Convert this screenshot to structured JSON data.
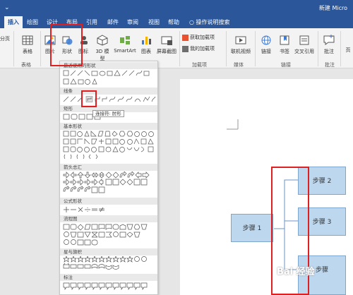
{
  "window": {
    "title": "新建 Micro"
  },
  "tabs": [
    {
      "label": "插入",
      "active": true
    },
    {
      "label": "绘图"
    },
    {
      "label": "设计"
    },
    {
      "label": "布局"
    },
    {
      "label": "引用"
    },
    {
      "label": "邮件"
    },
    {
      "label": "审阅"
    },
    {
      "label": "视图"
    },
    {
      "label": "帮助"
    }
  ],
  "tell_me": "操作说明搜索",
  "ribbon": {
    "page_btn": "分页",
    "table_btn": "表格",
    "picture_btn": "图片",
    "shapes_btn": "形状",
    "icons_btn": "图标",
    "model3d_btn": "3D 模型",
    "smartart_btn": "SmartArt",
    "chart_btn": "图表",
    "screenshot_btn": "屏幕截图",
    "get_addins": "获取加载项",
    "my_addins": "我的加载项",
    "online_video": "联机视频",
    "link_btn": "链接",
    "bookmark_btn": "书签",
    "crossref_btn": "交叉引用",
    "comment_btn": "批注",
    "last_btn": "页",
    "groups": {
      "tables": "表格",
      "addins": "加载项",
      "media": "媒体",
      "links": "链接",
      "comments": "批注"
    }
  },
  "shapes_gallery": {
    "sections": {
      "recent": "最近使用的形状",
      "lines": "线条",
      "rectangles": "矩形",
      "basic": "基本形状",
      "arrows": "箭头总汇",
      "equation": "公式形状",
      "flowchart": "流程图",
      "stars": "星与旗帜",
      "callouts": "标注"
    },
    "tooltip": "连接符: 肘形"
  },
  "document": {
    "step1": "步骤 1",
    "step2": "步骤 2",
    "step3": "步骤 3",
    "step4": "步骤"
  },
  "colors": {
    "accent": "#2b579a",
    "highlight": "#e02020",
    "box_fill": "#bdd7ee"
  }
}
